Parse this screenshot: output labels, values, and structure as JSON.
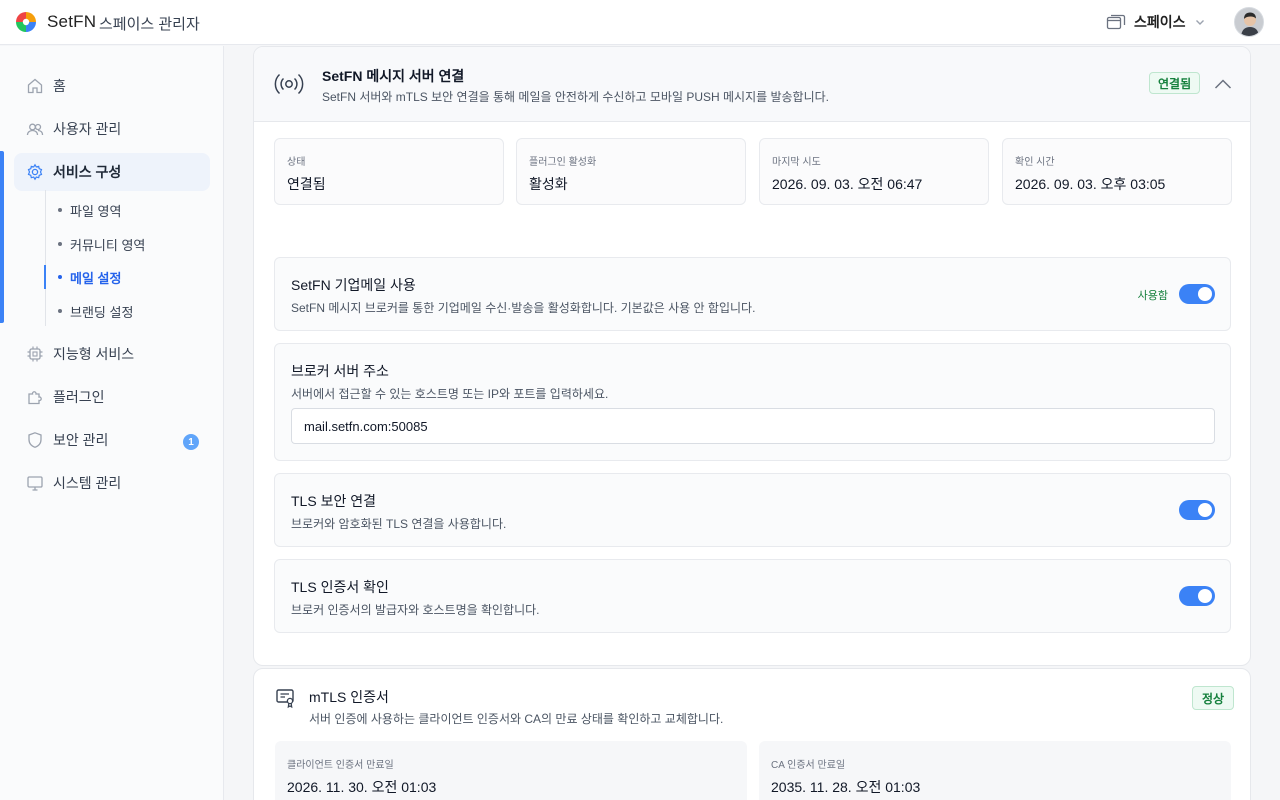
{
  "header": {
    "brand": "SetFN",
    "subtitle": "스페이스 관리자",
    "space_label": "스페이스"
  },
  "sidebar": {
    "items": [
      {
        "label": "홈"
      },
      {
        "label": "사용자 관리"
      },
      {
        "label": "서비스 구성"
      },
      {
        "label": "지능형 서비스"
      },
      {
        "label": "플러그인"
      },
      {
        "label": "보안 관리",
        "badge": "1"
      },
      {
        "label": "시스템 관리"
      }
    ],
    "subitems": [
      {
        "label": "파일 영역"
      },
      {
        "label": "커뮤니티 영역"
      },
      {
        "label": "메일 설정"
      },
      {
        "label": "브랜딩 설정"
      }
    ]
  },
  "server": {
    "title": "SetFN 메시지 서버 연결",
    "description": "SetFN 서버와 mTLS 보안 연결을 통해 메일을 안전하게 수신하고 모바일 PUSH 메시지를 발송합니다.",
    "status_pill": "연결됨",
    "stats": [
      {
        "label": "상태",
        "value": "연결됨"
      },
      {
        "label": "플러그인 활성화",
        "value": "활성화"
      },
      {
        "label": "마지막 시도",
        "value": "2026. 09. 03. 오전 06:47"
      },
      {
        "label": "확인 시간",
        "value": "2026. 09. 03. 오후 03:05"
      }
    ],
    "enterprise": {
      "title": "SetFN 기업메일 사용",
      "description": "SetFN 메시지 브로커를 통한 기업메일 수신·발송을 활성화합니다. 기본값은 사용 안 함입니다.",
      "toggle_label": "사용함",
      "enabled": true
    },
    "broker": {
      "title": "브로커 서버 주소",
      "description": "서버에서 접근할 수 있는 호스트명 또는 IP와 포트를 입력하세요.",
      "value": "mail.setfn.com:50085"
    },
    "tls": {
      "title": "TLS 보안 연결",
      "description": "브로커와 암호화된 TLS 연결을 사용합니다.",
      "enabled": true
    },
    "tls_verify": {
      "title": "TLS 인증서 확인",
      "description": "브로커 인증서의 발급자와 호스트명을 확인합니다.",
      "enabled": true
    }
  },
  "mtls": {
    "title": "mTLS 인증서",
    "description": "서버 인증에 사용하는 클라이언트 인증서와 CA의 만료 상태를 확인하고 교체합니다.",
    "status_pill": "정상",
    "client_label": "클라이언트 인증서 만료일",
    "client_value": "2026. 11. 30. 오전 01:03",
    "ca_label": "CA 인증서 만료일",
    "ca_value": "2035. 11. 28. 오전 01:03"
  },
  "colors": {
    "accent": "#3b82f6",
    "success": "#15803d"
  }
}
